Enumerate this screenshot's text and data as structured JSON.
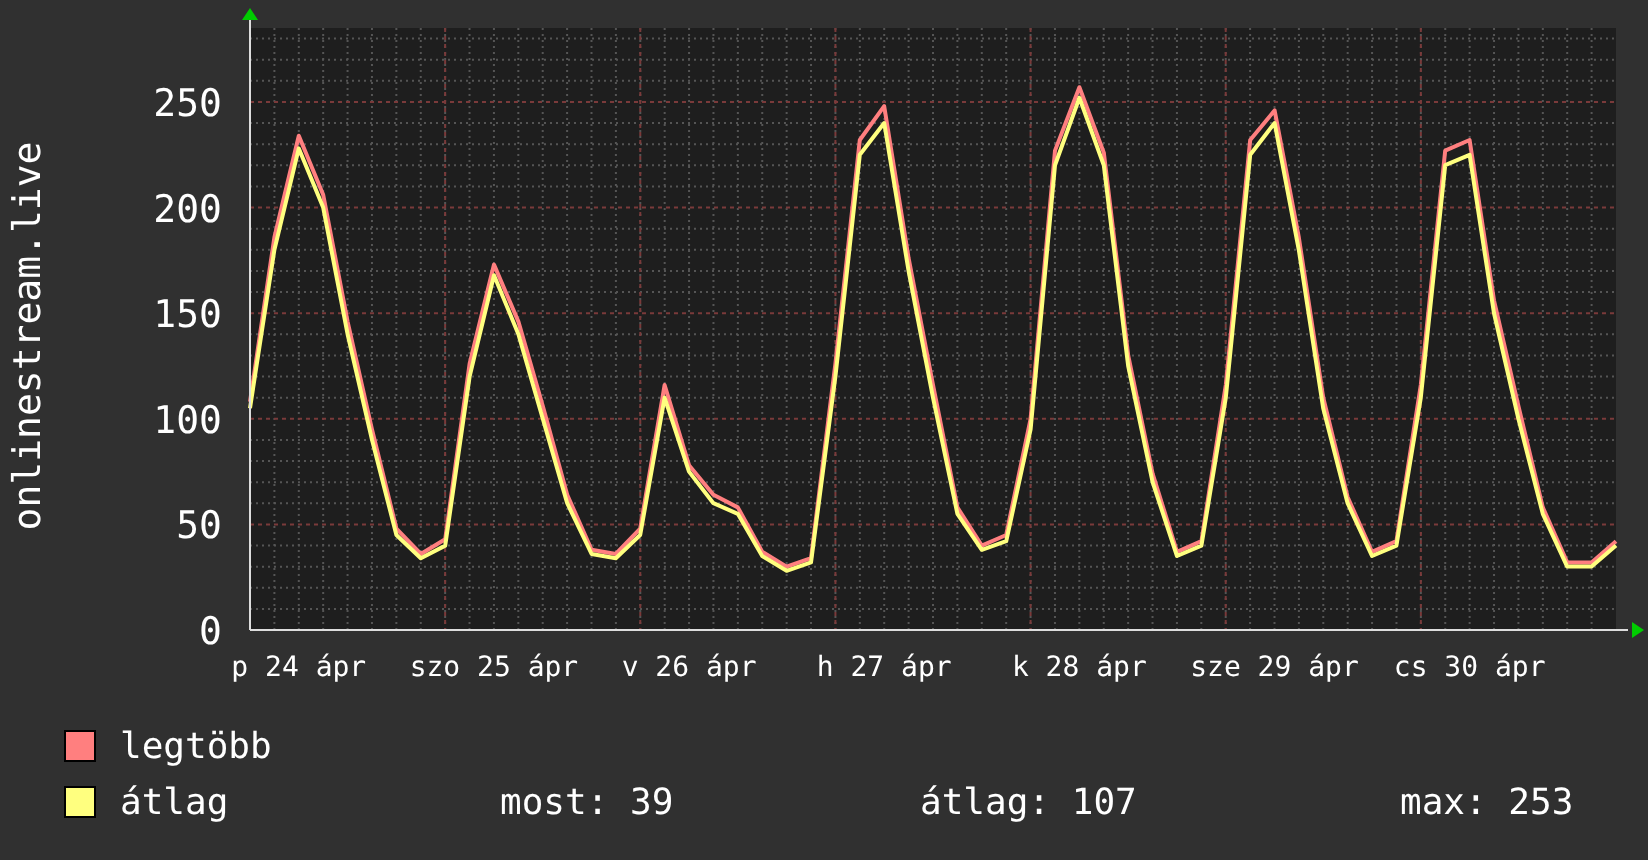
{
  "chart": {
    "chart_data": {
      "type": "line",
      "grid": true,
      "ylabel": "onlinestream.live",
      "ylim": [
        0,
        285
      ],
      "categories": [
        null,
        null,
        "p 24 ápr",
        null,
        null,
        null,
        null,
        null,
        null,
        null,
        "szo 25 ápr",
        null,
        null,
        null,
        null,
        null,
        null,
        null,
        "v 26 ápr",
        null,
        null,
        null,
        null,
        null,
        null,
        null,
        "h 27 ápr",
        null,
        null,
        null,
        null,
        null,
        null,
        null,
        "k 28 ápr",
        null,
        null,
        null,
        null,
        null,
        null,
        null,
        "sze 29 ápr",
        null,
        null,
        null,
        null,
        null,
        null,
        null,
        "cs 30 ápr",
        null,
        null,
        null,
        null,
        null,
        null
      ],
      "yticks": [
        0,
        50,
        100,
        150,
        200,
        250
      ],
      "series": [
        {
          "name": "legtöbb",
          "color": "#ff7f7f",
          "values": [
            108,
            186,
            234,
            206,
            146,
            95,
            48,
            36,
            43,
            126,
            173,
            146,
            106,
            64,
            38,
            36,
            48,
            116,
            78,
            64,
            58,
            37,
            30,
            34,
            126,
            232,
            248,
            176,
            116,
            58,
            40,
            45,
            100,
            227,
            257,
            226,
            130,
            74,
            37,
            42,
            116,
            232,
            246,
            186,
            110,
            63,
            37,
            42,
            116,
            227,
            232,
            156,
            106,
            58,
            32,
            32,
            42
          ]
        },
        {
          "name": "átlag",
          "color": "#ffff7f",
          "values": [
            105,
            180,
            228,
            200,
            140,
            90,
            45,
            34,
            40,
            120,
            168,
            140,
            100,
            60,
            36,
            34,
            45,
            110,
            75,
            60,
            55,
            35,
            28,
            32,
            120,
            225,
            240,
            170,
            110,
            55,
            38,
            42,
            95,
            220,
            252,
            220,
            125,
            70,
            35,
            40,
            110,
            225,
            240,
            180,
            105,
            60,
            35,
            40,
            110,
            220,
            225,
            150,
            100,
            55,
            30,
            30,
            40
          ]
        }
      ]
    }
  },
  "legend": {
    "stats": [
      "most: 39",
      "átlag: 107",
      "max: 253"
    ]
  }
}
